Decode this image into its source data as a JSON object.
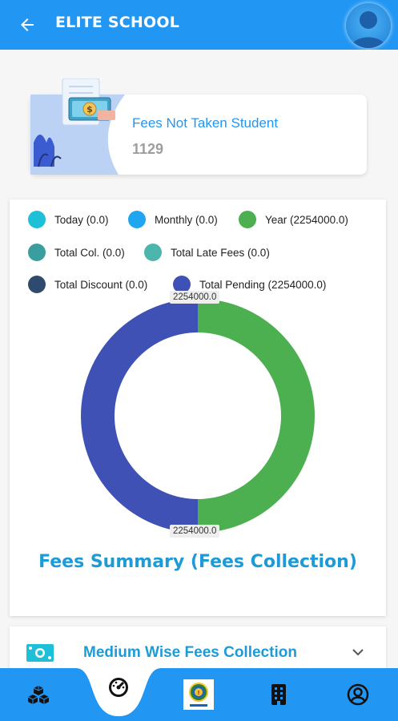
{
  "appbar": {
    "title": "ELITE SCHOOL",
    "back_icon": "arrow-left-icon",
    "avatar_icon": "user-avatar-icon",
    "color": "#2196f3"
  },
  "fees_not_taken": {
    "label": "Fees Not Taken Student",
    "count": "1129",
    "illustration": "money-payment-illustration"
  },
  "chart": {
    "legend": [
      {
        "label": "Today (0.0)",
        "color": "#1ec0d9"
      },
      {
        "label": "Monthly (0.0)",
        "color": "#1fa6f0"
      },
      {
        "label": "Year (2254000.0)",
        "color": "#4caf50"
      },
      {
        "label": "Total Col. (0.0)",
        "color": "#3a9e9e"
      },
      {
        "label": "Total Late Fees (0.0)",
        "color": "#4db6ac"
      },
      {
        "label": "Total Discount (0.0)",
        "color": "#2e4a6e"
      },
      {
        "label": "Total Pending (2254000.0)",
        "color": "#3f51b5"
      }
    ],
    "top_label": "2254000.0",
    "bottom_label": "2254000.0",
    "title": "Fees Summary (Fees Collection)"
  },
  "chart_data": {
    "type": "pie",
    "categories": [
      "Today",
      "Monthly",
      "Year",
      "Total Col.",
      "Total Late Fees",
      "Total Discount",
      "Total Pending"
    ],
    "values": [
      0.0,
      0.0,
      2254000.0,
      0.0,
      0.0,
      0.0,
      2254000.0
    ],
    "colors": [
      "#1ec0d9",
      "#1fa6f0",
      "#4caf50",
      "#3a9e9e",
      "#4db6ac",
      "#2e4a6e",
      "#3f51b5"
    ],
    "title": "Fees Summary (Fees Collection)",
    "donut": true
  },
  "medium": {
    "label": "Medium Wise Fees Collection",
    "icon": "money-bill-icon",
    "chevron": "chevron-down-icon"
  },
  "bottom_nav": {
    "items": [
      {
        "icon": "cubes-icon"
      },
      {
        "icon": "dashboard-gauge-icon"
      },
      {
        "icon": "school-logo-icon"
      },
      {
        "icon": "building-icon"
      },
      {
        "icon": "profile-icon"
      }
    ]
  }
}
